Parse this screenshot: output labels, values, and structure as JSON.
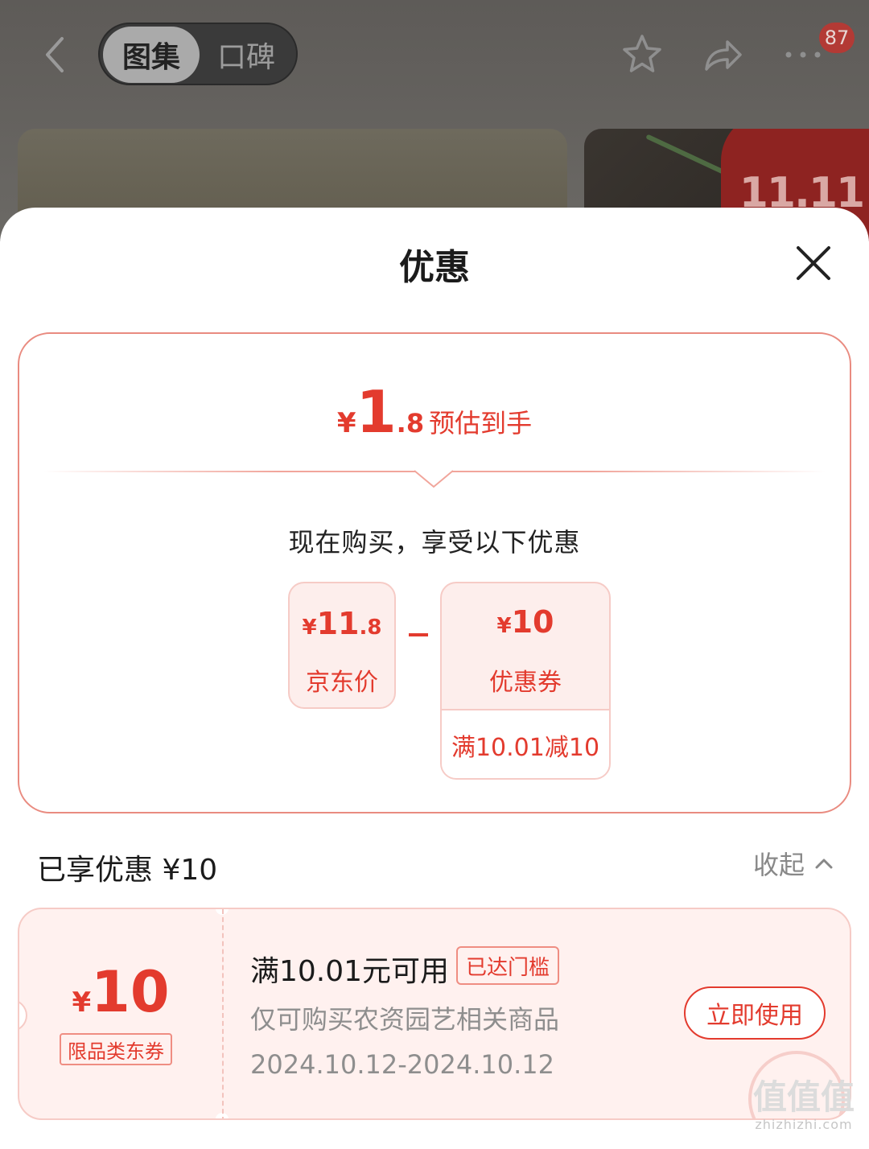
{
  "background": {
    "segment": {
      "active": "图集",
      "inactive": "口碑"
    },
    "badge_count": "87",
    "brand_badge": "11.11",
    "icons": {
      "back": "chevron-left-icon",
      "favorite": "star-icon",
      "share": "share-icon",
      "more": "more-dots-icon"
    }
  },
  "sheet": {
    "title": "优惠",
    "summary": {
      "estimate": {
        "currency": "¥",
        "int": "1",
        "dec": ".8",
        "label": "预估到手"
      },
      "subtitle": "现在购买，享受以下优惠",
      "price_box": {
        "currency": "¥",
        "int": "11",
        "dec": ".8",
        "label": "京东价"
      },
      "operator": "-",
      "coupon_box": {
        "currency": "¥",
        "int": "10",
        "label": "优惠券",
        "condition": "满10.01减10"
      }
    },
    "enjoyed": {
      "label": "已享优惠 ¥10",
      "collapse": "收起"
    },
    "coupon": {
      "currency": "¥",
      "amount": "10",
      "type_tag": "限品类东券",
      "title": "满10.01元可用",
      "reached_tag": "已达门槛",
      "description": "仅可购买农资园艺相关商品",
      "validity": "2024.10.12-2024.10.12",
      "use_button": "立即使用"
    }
  },
  "watermark": {
    "zh": "值值值",
    "en": "zhizhizhi.com"
  },
  "colors": {
    "accent": "#e33b2e",
    "accent_light": "#fdeeec",
    "border": "#e98b80"
  }
}
